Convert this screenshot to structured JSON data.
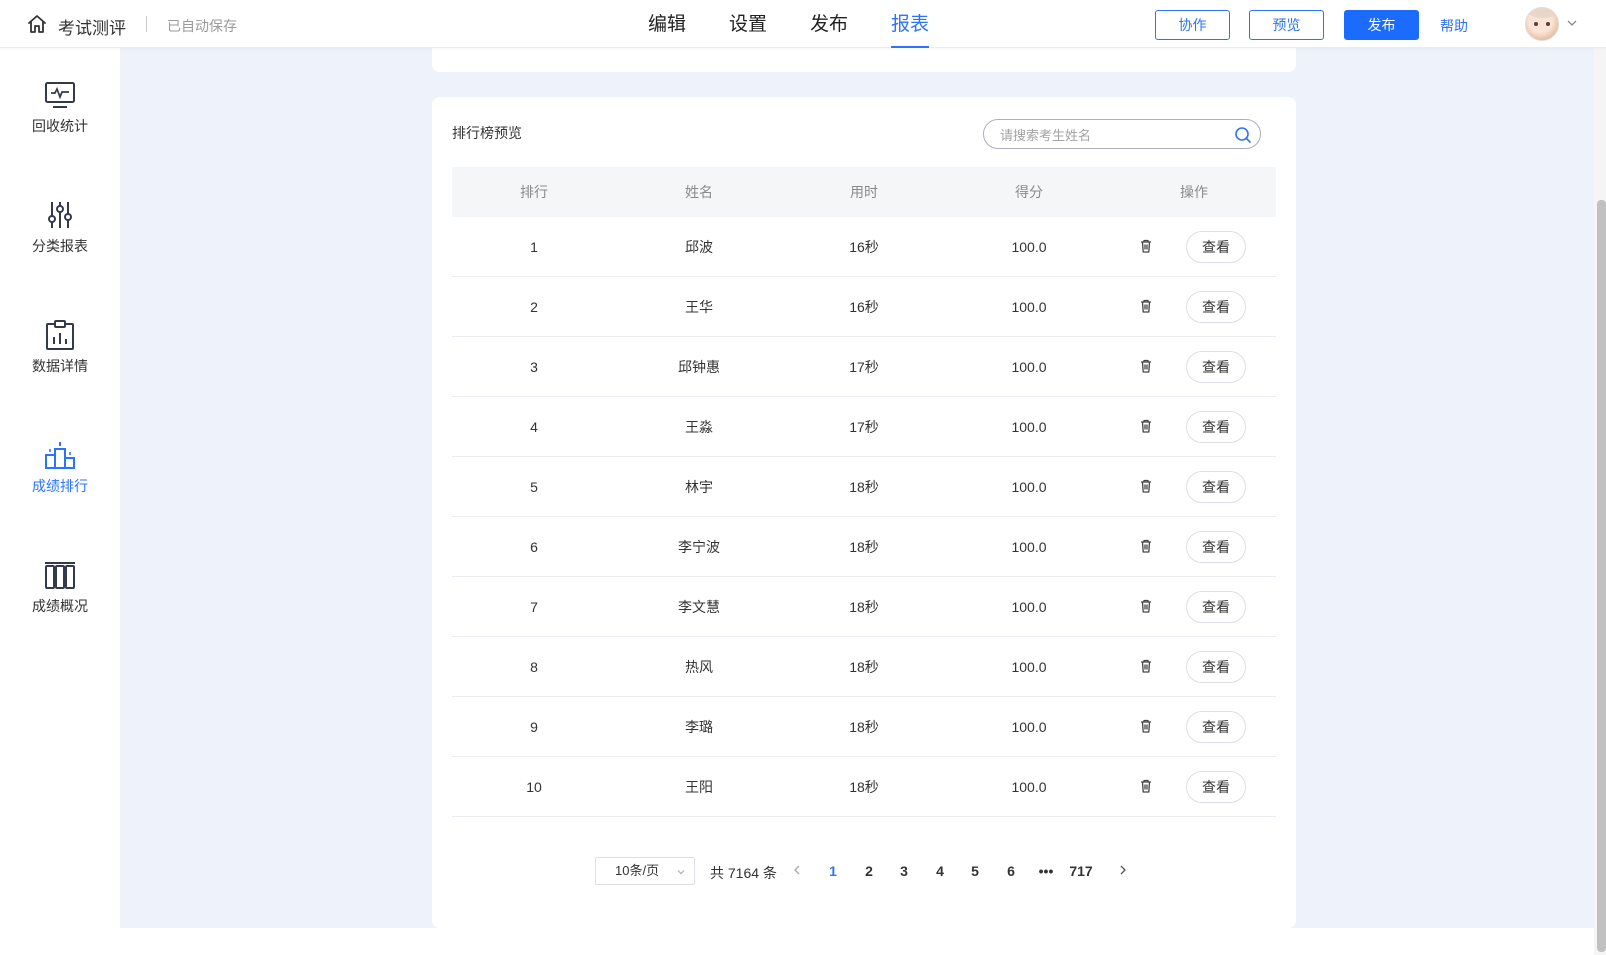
{
  "header": {
    "app_title": "考试测评",
    "autosave": "已自动保存",
    "tabs": [
      {
        "label": "编辑",
        "active": false
      },
      {
        "label": "设置",
        "active": false
      },
      {
        "label": "发布",
        "active": false
      },
      {
        "label": "报表",
        "active": true
      }
    ],
    "collaborate_label": "协作",
    "preview_label": "预览",
    "publish_label": "发布",
    "help_label": "帮助"
  },
  "sidebar": {
    "items": [
      {
        "label": "回收统计",
        "icon": "monitor-chart-icon",
        "active": false
      },
      {
        "label": "分类报表",
        "icon": "sliders-icon",
        "active": false
      },
      {
        "label": "数据详情",
        "icon": "clipboard-chart-icon",
        "active": false
      },
      {
        "label": "成绩排行",
        "icon": "podium-icon",
        "active": true
      },
      {
        "label": "成绩概况",
        "icon": "bars-overview-icon",
        "active": false
      }
    ]
  },
  "ranking": {
    "title": "排行榜预览",
    "search_placeholder": "请搜索考生姓名",
    "columns": [
      "排行",
      "姓名",
      "用时",
      "得分",
      "操作"
    ],
    "view_label": "查看",
    "rows": [
      {
        "rank": "1",
        "name": "邱波",
        "time": "16秒",
        "score": "100.0"
      },
      {
        "rank": "2",
        "name": "王华",
        "time": "16秒",
        "score": "100.0"
      },
      {
        "rank": "3",
        "name": "邱钟惠",
        "time": "17秒",
        "score": "100.0"
      },
      {
        "rank": "4",
        "name": "王淼",
        "time": "17秒",
        "score": "100.0"
      },
      {
        "rank": "5",
        "name": "林宇",
        "time": "18秒",
        "score": "100.0"
      },
      {
        "rank": "6",
        "name": "李宁波",
        "time": "18秒",
        "score": "100.0"
      },
      {
        "rank": "7",
        "name": "李文慧",
        "time": "18秒",
        "score": "100.0"
      },
      {
        "rank": "8",
        "name": "热风",
        "time": "18秒",
        "score": "100.0"
      },
      {
        "rank": "9",
        "name": "李璐",
        "time": "18秒",
        "score": "100.0"
      },
      {
        "rank": "10",
        "name": "王阳",
        "time": "18秒",
        "score": "100.0"
      }
    ]
  },
  "pagination": {
    "page_size": "10条/页",
    "total_label": "共 7164 条",
    "pages": [
      "1",
      "2",
      "3",
      "4",
      "5",
      "6",
      "•••",
      "717"
    ],
    "current_page": "1"
  },
  "colors": {
    "accent": "#2b73ff",
    "content_bg": "#eef2fa",
    "header_row_bg": "#f5f6f8"
  }
}
